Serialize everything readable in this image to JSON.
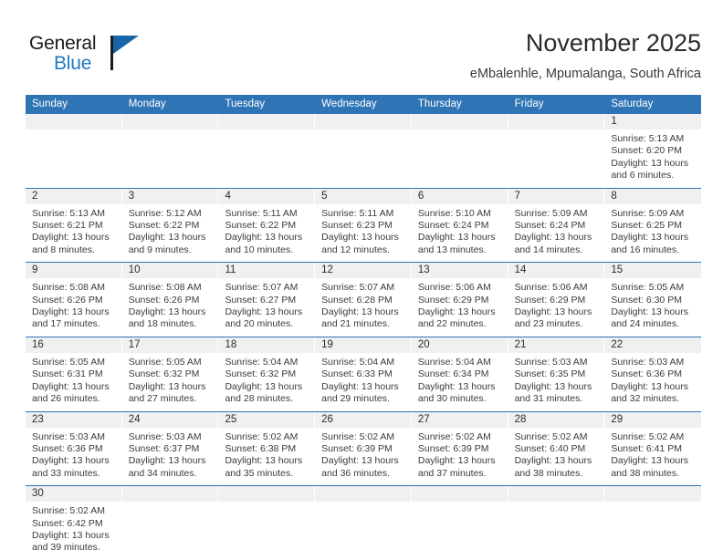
{
  "brand": {
    "name_part1": "General",
    "name_part2": "Blue",
    "flag_icon": "flag-icon"
  },
  "header": {
    "title": "November 2025",
    "subtitle": "eMbalenhle, Mpumalanga, South Africa"
  },
  "calendar": {
    "weekdays": [
      "Sunday",
      "Monday",
      "Tuesday",
      "Wednesday",
      "Thursday",
      "Friday",
      "Saturday"
    ],
    "accent_color": "#2f74b5",
    "day_band_color": "#f0f0f0",
    "weeks": [
      [
        {
          "day": "",
          "lines": []
        },
        {
          "day": "",
          "lines": []
        },
        {
          "day": "",
          "lines": []
        },
        {
          "day": "",
          "lines": []
        },
        {
          "day": "",
          "lines": []
        },
        {
          "day": "",
          "lines": []
        },
        {
          "day": "1",
          "lines": [
            "Sunrise: 5:13 AM",
            "Sunset: 6:20 PM",
            "Daylight: 13 hours",
            "and 6 minutes."
          ]
        }
      ],
      [
        {
          "day": "2",
          "lines": [
            "Sunrise: 5:13 AM",
            "Sunset: 6:21 PM",
            "Daylight: 13 hours",
            "and 8 minutes."
          ]
        },
        {
          "day": "3",
          "lines": [
            "Sunrise: 5:12 AM",
            "Sunset: 6:22 PM",
            "Daylight: 13 hours",
            "and 9 minutes."
          ]
        },
        {
          "day": "4",
          "lines": [
            "Sunrise: 5:11 AM",
            "Sunset: 6:22 PM",
            "Daylight: 13 hours",
            "and 10 minutes."
          ]
        },
        {
          "day": "5",
          "lines": [
            "Sunrise: 5:11 AM",
            "Sunset: 6:23 PM",
            "Daylight: 13 hours",
            "and 12 minutes."
          ]
        },
        {
          "day": "6",
          "lines": [
            "Sunrise: 5:10 AM",
            "Sunset: 6:24 PM",
            "Daylight: 13 hours",
            "and 13 minutes."
          ]
        },
        {
          "day": "7",
          "lines": [
            "Sunrise: 5:09 AM",
            "Sunset: 6:24 PM",
            "Daylight: 13 hours",
            "and 14 minutes."
          ]
        },
        {
          "day": "8",
          "lines": [
            "Sunrise: 5:09 AM",
            "Sunset: 6:25 PM",
            "Daylight: 13 hours",
            "and 16 minutes."
          ]
        }
      ],
      [
        {
          "day": "9",
          "lines": [
            "Sunrise: 5:08 AM",
            "Sunset: 6:26 PM",
            "Daylight: 13 hours",
            "and 17 minutes."
          ]
        },
        {
          "day": "10",
          "lines": [
            "Sunrise: 5:08 AM",
            "Sunset: 6:26 PM",
            "Daylight: 13 hours",
            "and 18 minutes."
          ]
        },
        {
          "day": "11",
          "lines": [
            "Sunrise: 5:07 AM",
            "Sunset: 6:27 PM",
            "Daylight: 13 hours",
            "and 20 minutes."
          ]
        },
        {
          "day": "12",
          "lines": [
            "Sunrise: 5:07 AM",
            "Sunset: 6:28 PM",
            "Daylight: 13 hours",
            "and 21 minutes."
          ]
        },
        {
          "day": "13",
          "lines": [
            "Sunrise: 5:06 AM",
            "Sunset: 6:29 PM",
            "Daylight: 13 hours",
            "and 22 minutes."
          ]
        },
        {
          "day": "14",
          "lines": [
            "Sunrise: 5:06 AM",
            "Sunset: 6:29 PM",
            "Daylight: 13 hours",
            "and 23 minutes."
          ]
        },
        {
          "day": "15",
          "lines": [
            "Sunrise: 5:05 AM",
            "Sunset: 6:30 PM",
            "Daylight: 13 hours",
            "and 24 minutes."
          ]
        }
      ],
      [
        {
          "day": "16",
          "lines": [
            "Sunrise: 5:05 AM",
            "Sunset: 6:31 PM",
            "Daylight: 13 hours",
            "and 26 minutes."
          ]
        },
        {
          "day": "17",
          "lines": [
            "Sunrise: 5:05 AM",
            "Sunset: 6:32 PM",
            "Daylight: 13 hours",
            "and 27 minutes."
          ]
        },
        {
          "day": "18",
          "lines": [
            "Sunrise: 5:04 AM",
            "Sunset: 6:32 PM",
            "Daylight: 13 hours",
            "and 28 minutes."
          ]
        },
        {
          "day": "19",
          "lines": [
            "Sunrise: 5:04 AM",
            "Sunset: 6:33 PM",
            "Daylight: 13 hours",
            "and 29 minutes."
          ]
        },
        {
          "day": "20",
          "lines": [
            "Sunrise: 5:04 AM",
            "Sunset: 6:34 PM",
            "Daylight: 13 hours",
            "and 30 minutes."
          ]
        },
        {
          "day": "21",
          "lines": [
            "Sunrise: 5:03 AM",
            "Sunset: 6:35 PM",
            "Daylight: 13 hours",
            "and 31 minutes."
          ]
        },
        {
          "day": "22",
          "lines": [
            "Sunrise: 5:03 AM",
            "Sunset: 6:36 PM",
            "Daylight: 13 hours",
            "and 32 minutes."
          ]
        }
      ],
      [
        {
          "day": "23",
          "lines": [
            "Sunrise: 5:03 AM",
            "Sunset: 6:36 PM",
            "Daylight: 13 hours",
            "and 33 minutes."
          ]
        },
        {
          "day": "24",
          "lines": [
            "Sunrise: 5:03 AM",
            "Sunset: 6:37 PM",
            "Daylight: 13 hours",
            "and 34 minutes."
          ]
        },
        {
          "day": "25",
          "lines": [
            "Sunrise: 5:02 AM",
            "Sunset: 6:38 PM",
            "Daylight: 13 hours",
            "and 35 minutes."
          ]
        },
        {
          "day": "26",
          "lines": [
            "Sunrise: 5:02 AM",
            "Sunset: 6:39 PM",
            "Daylight: 13 hours",
            "and 36 minutes."
          ]
        },
        {
          "day": "27",
          "lines": [
            "Sunrise: 5:02 AM",
            "Sunset: 6:39 PM",
            "Daylight: 13 hours",
            "and 37 minutes."
          ]
        },
        {
          "day": "28",
          "lines": [
            "Sunrise: 5:02 AM",
            "Sunset: 6:40 PM",
            "Daylight: 13 hours",
            "and 38 minutes."
          ]
        },
        {
          "day": "29",
          "lines": [
            "Sunrise: 5:02 AM",
            "Sunset: 6:41 PM",
            "Daylight: 13 hours",
            "and 38 minutes."
          ]
        }
      ],
      [
        {
          "day": "30",
          "lines": [
            "Sunrise: 5:02 AM",
            "Sunset: 6:42 PM",
            "Daylight: 13 hours",
            "and 39 minutes."
          ]
        },
        {
          "day": "",
          "lines": []
        },
        {
          "day": "",
          "lines": []
        },
        {
          "day": "",
          "lines": []
        },
        {
          "day": "",
          "lines": []
        },
        {
          "day": "",
          "lines": []
        },
        {
          "day": "",
          "lines": []
        }
      ]
    ]
  }
}
